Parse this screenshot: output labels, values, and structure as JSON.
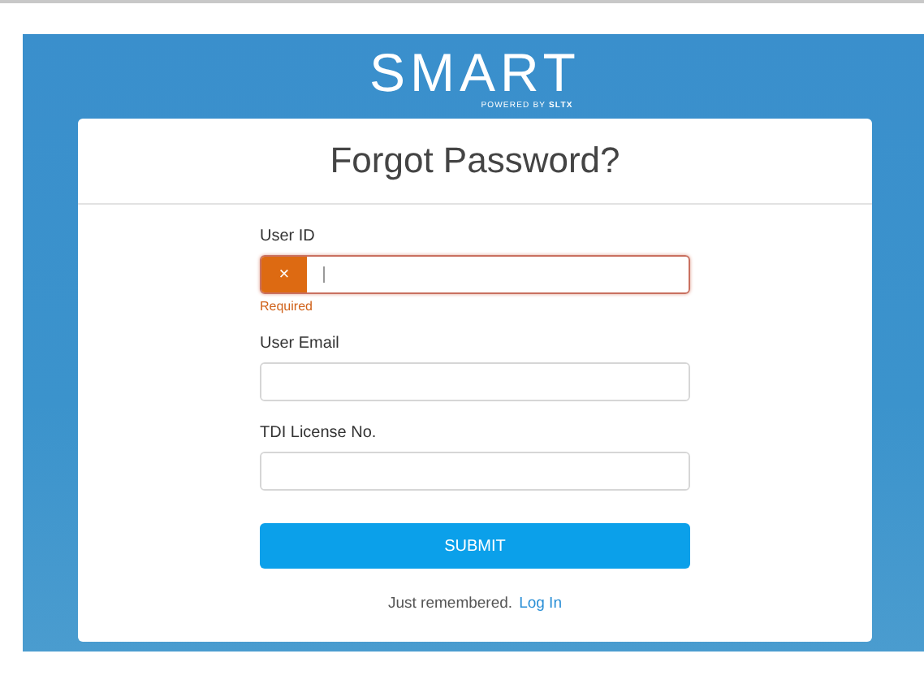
{
  "logo": {
    "name": "SMART",
    "tagline_prefix": "POWERED BY",
    "tagline_brand": "SLTX"
  },
  "title": "Forgot Password?",
  "fields": [
    {
      "label": "User ID",
      "error": true,
      "error_icon": "×",
      "error_message": "Required",
      "focused": true
    },
    {
      "label": "User Email",
      "error": false,
      "focused": false
    },
    {
      "label": "TDI License No.",
      "error": false,
      "focused": false
    }
  ],
  "submit": "SUBMIT",
  "footer": {
    "text": "Just remembered.",
    "link": "Log In"
  }
}
